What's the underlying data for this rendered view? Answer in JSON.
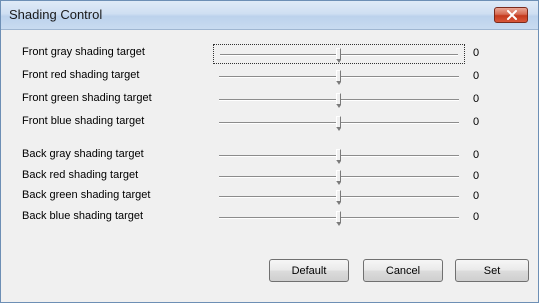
{
  "window": {
    "title": "Shading Control"
  },
  "sliders": [
    {
      "label": "Front gray shading target",
      "value": "0",
      "level": 0.5
    },
    {
      "label": "Front red shading target",
      "value": "0",
      "level": 0.5
    },
    {
      "label": "Front green shading target",
      "value": "0",
      "level": 0.5
    },
    {
      "label": "Front blue shading target",
      "value": "0",
      "level": 0.5
    },
    {
      "label": "Back gray shading target",
      "value": "0",
      "level": 0.5
    },
    {
      "label": "Back red shading target",
      "value": "0",
      "level": 0.5
    },
    {
      "label": "Back green shading target",
      "value": "0",
      "level": 0.5
    },
    {
      "label": "Back blue shading target",
      "value": "0",
      "level": 0.5
    }
  ],
  "buttons": {
    "default_label": "Default",
    "cancel_label": "Cancel",
    "set_label": "Set"
  },
  "colors": {
    "title_bar": "#cfdff2",
    "close_button": "#c4391d",
    "dialog_background": "#f0f0f0"
  }
}
